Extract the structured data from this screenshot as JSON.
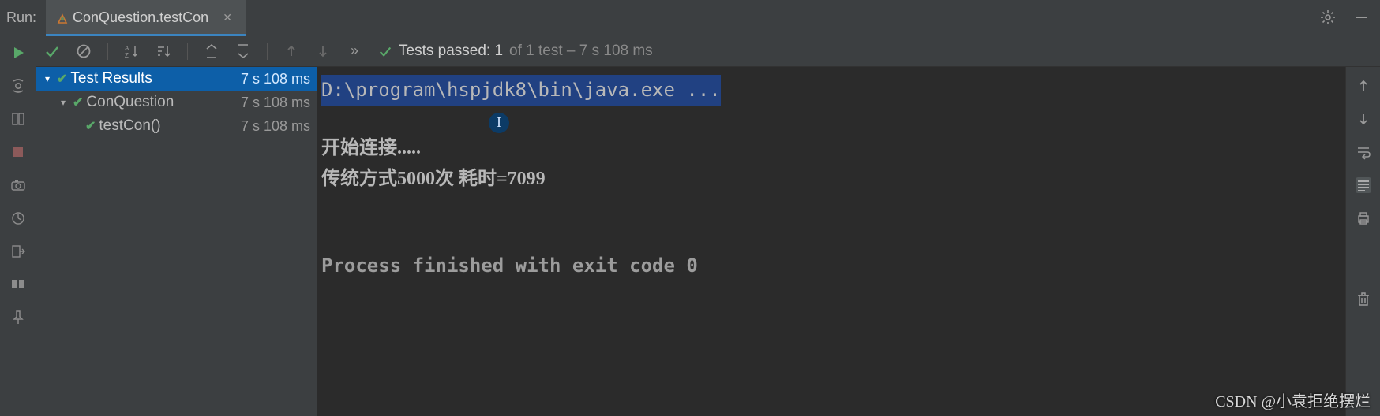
{
  "header": {
    "run_label": "Run:",
    "tab_label": "ConQuestion.testCon"
  },
  "toolbar": {
    "summary_prefix": "Tests passed:",
    "summary_count": "1",
    "summary_rest": "of 1 test – 7 s 108 ms"
  },
  "tree": {
    "root": {
      "label": "Test Results",
      "time": "7 s 108 ms"
    },
    "class": {
      "label": "ConQuestion",
      "time": "7 s 108 ms"
    },
    "method": {
      "label": "testCon()",
      "time": "7 s 108 ms"
    }
  },
  "console": {
    "line1": "D:\\program\\hspjdk8\\bin\\java.exe ...",
    "line2": "开始连接.....",
    "line3": "传统方式5000次 耗时=7099",
    "line4": "Process finished with exit code 0"
  },
  "cursor_glyph": "I",
  "watermark": "CSDN @小袁拒绝摆烂"
}
